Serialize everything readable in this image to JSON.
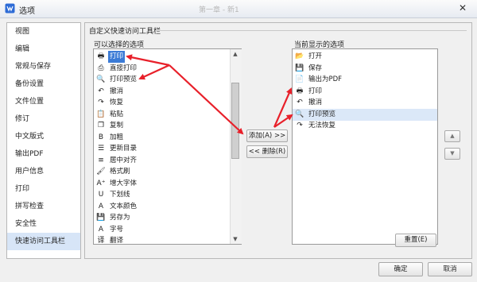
{
  "window": {
    "title": "选项",
    "ghost_title": "第一章 - 新1",
    "close_glyph": "✕"
  },
  "sidebar": {
    "items": [
      {
        "label": "视图"
      },
      {
        "label": "编辑"
      },
      {
        "label": "常规与保存"
      },
      {
        "label": "备份设置"
      },
      {
        "label": "文件位置"
      },
      {
        "label": "修订"
      },
      {
        "label": "中文版式"
      },
      {
        "label": "输出PDF"
      },
      {
        "label": "用户信息"
      },
      {
        "label": "打印"
      },
      {
        "label": "拼写检查"
      },
      {
        "label": "安全性"
      },
      {
        "label": "快速访问工具栏",
        "selected": true
      }
    ]
  },
  "panel": {
    "group_title": "自定义快速访问工具栏",
    "available_label": "可以选择的选项",
    "current_label": "当前显示的选项",
    "available_items": [
      {
        "label": "打印",
        "icon": "printer-icon",
        "glyph": "🖶",
        "selected": true
      },
      {
        "label": "直接打印",
        "icon": "direct-print-icon",
        "glyph": "⎙"
      },
      {
        "label": "打印预览",
        "icon": "print-preview-icon",
        "glyph": "🔍"
      },
      {
        "label": "撤消",
        "icon": "undo-icon",
        "glyph": "↶"
      },
      {
        "label": "恢复",
        "icon": "redo-icon",
        "glyph": "↷"
      },
      {
        "label": "粘贴",
        "icon": "paste-icon",
        "glyph": "📋"
      },
      {
        "label": "复制",
        "icon": "copy-icon",
        "glyph": "❐"
      },
      {
        "label": "加粗",
        "icon": "bold-icon",
        "glyph": "B"
      },
      {
        "label": "更新目录",
        "icon": "update-toc-icon",
        "glyph": "☰"
      },
      {
        "label": "居中对齐",
        "icon": "center-align-icon",
        "glyph": "≡"
      },
      {
        "label": "格式刷",
        "icon": "format-brush-icon",
        "glyph": "🖌"
      },
      {
        "label": "增大字体",
        "icon": "grow-font-icon",
        "glyph": "A⁺"
      },
      {
        "label": "下划线",
        "icon": "underline-icon",
        "glyph": "U"
      },
      {
        "label": "文本颜色",
        "icon": "text-color-icon",
        "glyph": "A"
      },
      {
        "label": "另存为",
        "icon": "save-as-icon",
        "glyph": "💾"
      },
      {
        "label": "字号",
        "icon": "font-size-icon",
        "glyph": "A"
      },
      {
        "label": "翻译",
        "icon": "translate-icon",
        "glyph": "译"
      }
    ],
    "current_items": [
      {
        "label": "打开",
        "icon": "open-folder-icon",
        "glyph": "📂"
      },
      {
        "label": "保存",
        "icon": "save-icon",
        "glyph": "💾"
      },
      {
        "label": "输出为PDF",
        "icon": "pdf-icon",
        "glyph": "📄"
      },
      {
        "label": "打印",
        "icon": "printer-icon",
        "glyph": "🖶"
      },
      {
        "label": "撤消",
        "icon": "undo-icon",
        "glyph": "↶"
      },
      {
        "label": "打印预览",
        "icon": "print-preview-icon",
        "glyph": "🔍",
        "highlighted": true
      },
      {
        "label": "无法恢复",
        "icon": "redo-disabled-icon",
        "glyph": "↷"
      }
    ],
    "add_button": "添加(A) >>",
    "remove_button": "<< 删除(R)",
    "move_up_glyph": "▲",
    "move_down_glyph": "▼",
    "reset_button": "重置(E)"
  },
  "footer": {
    "ok_button": "确定",
    "cancel_button": "取消"
  },
  "colors": {
    "annotation_arrow": "#e8202a",
    "selection": "#3b7bd6",
    "sidebar_selected": "#d7e5f7"
  }
}
